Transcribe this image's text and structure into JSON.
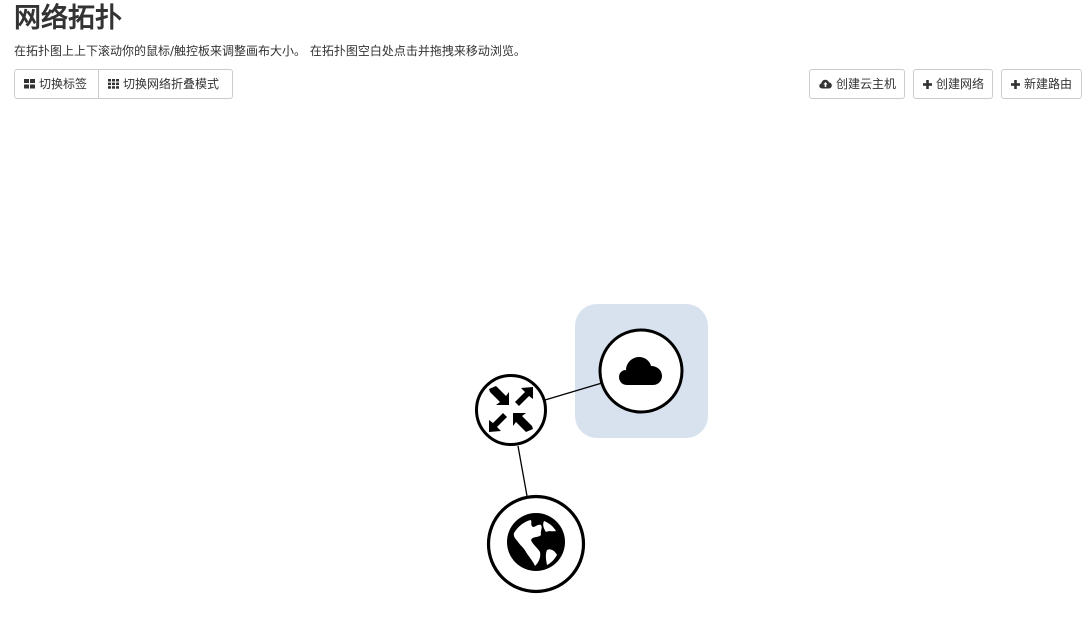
{
  "header": {
    "title": "网络拓扑",
    "help_text": "在拓扑图上上下滚动你的鼠标/触控板来调整画布大小。 在拓扑图空白处点击并拖拽来移动浏览。"
  },
  "toolbar_left": {
    "toggle_labels": "切换标签",
    "toggle_network_collapse": "切换网络折叠模式"
  },
  "toolbar_right": {
    "create_instance": "创建云主机",
    "create_network": "创建网络",
    "create_router": "新建路由"
  },
  "topology": {
    "nodes": [
      {
        "type": "router",
        "icon": "router-arrows-icon"
      },
      {
        "type": "network",
        "icon": "cloud-icon",
        "highlighted": true
      },
      {
        "type": "external-network",
        "icon": "globe-icon"
      }
    ],
    "colors": {
      "network_highlight": "#d8e2ef",
      "node_stroke": "#000000",
      "node_fill": "#ffffff"
    }
  }
}
